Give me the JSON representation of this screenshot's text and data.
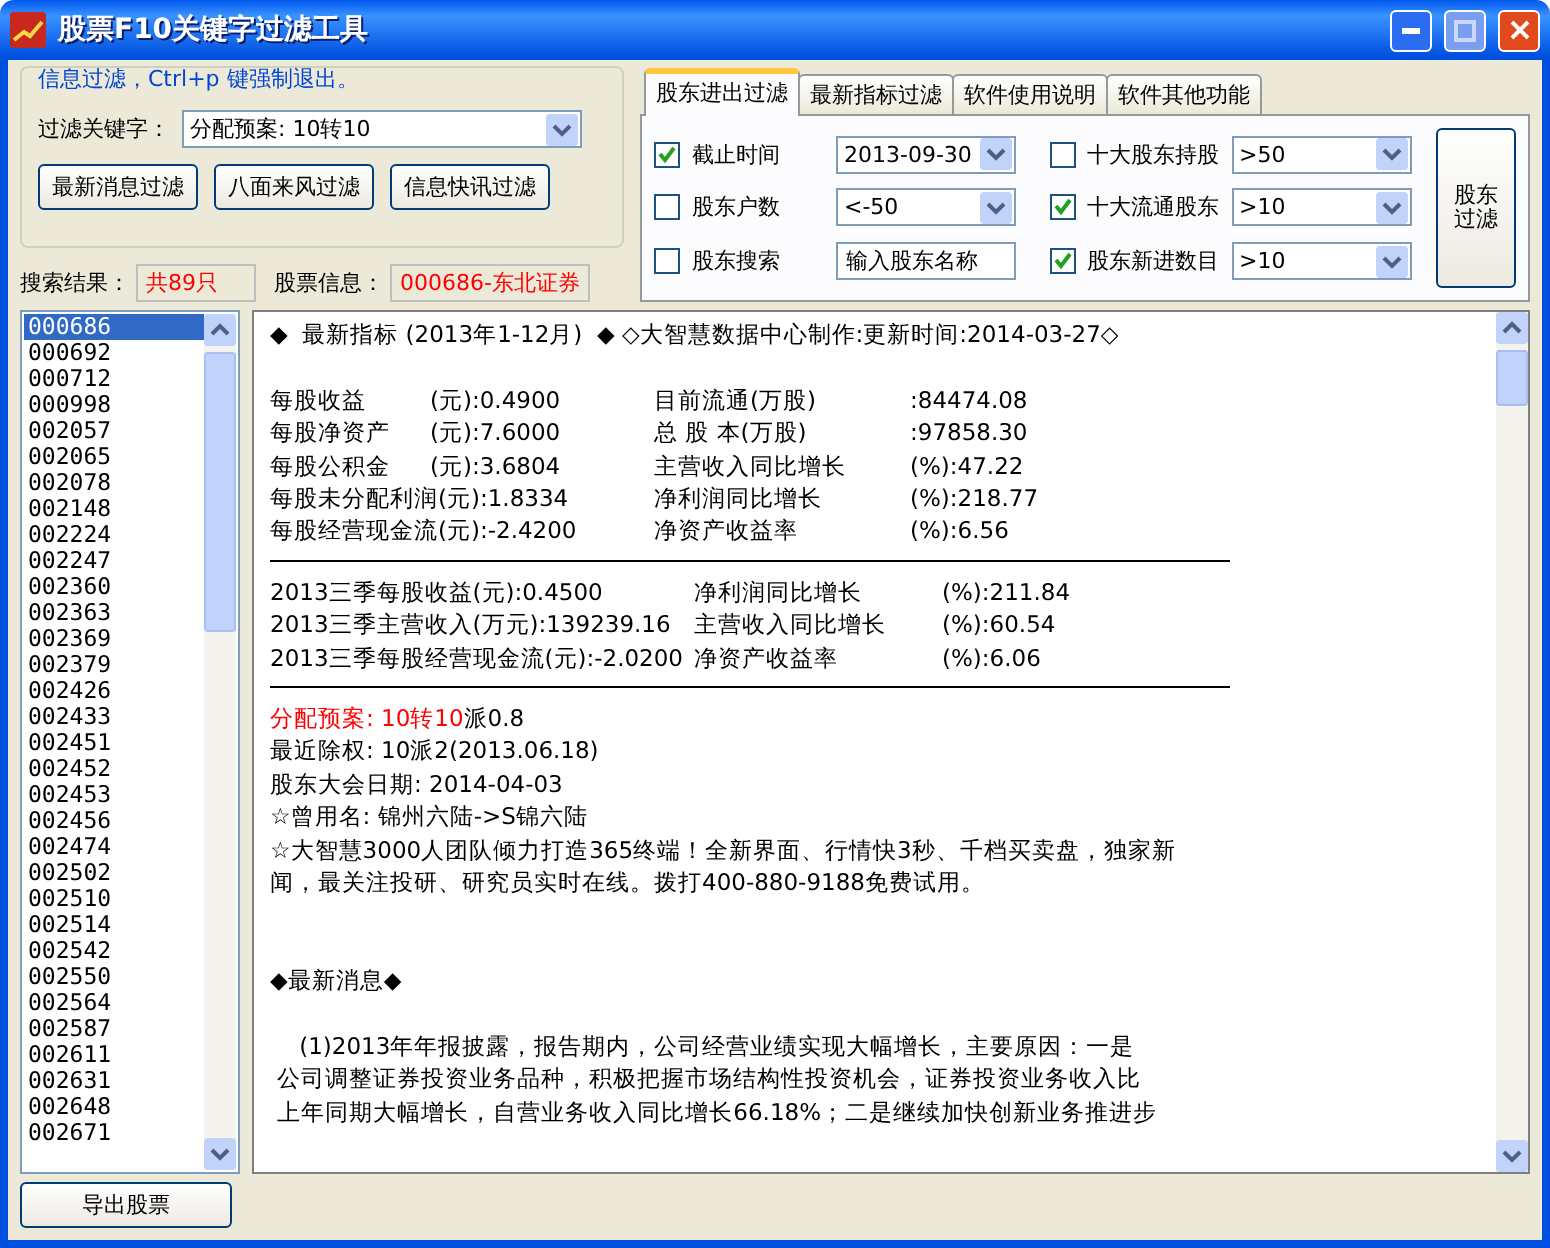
{
  "window": {
    "title": "股票F10关键字过滤工具"
  },
  "hint": "信息过滤，Ctrl+p 键强制退出。",
  "keyword": {
    "label": "过滤关键字：",
    "value": "分配预案: 10转10"
  },
  "filter_buttons": [
    "最新消息过滤",
    "八面来风过滤",
    "信息快讯过滤"
  ],
  "search": {
    "result_label": "搜索结果：",
    "result_value": "共89只",
    "info_label": "股票信息：",
    "info_value": "000686-东北证券"
  },
  "tabs": [
    {
      "label": "股东进出过滤",
      "selected": true
    },
    {
      "label": "最新指标过滤",
      "selected": false
    },
    {
      "label": "软件使用说明",
      "selected": false
    },
    {
      "label": "软件其他功能",
      "selected": false
    }
  ],
  "shareholder_filters": [
    {
      "label": "截止时间",
      "checked": true,
      "kind": "dropdown",
      "value": "2013-09-30"
    },
    {
      "label": "股东户数",
      "checked": false,
      "kind": "dropdown",
      "value": "<-50"
    },
    {
      "label": "股东搜索",
      "checked": false,
      "kind": "input",
      "value": "输入股东名称"
    },
    {
      "label": "十大股东持股",
      "checked": false,
      "kind": "dropdown",
      "value": ">50"
    },
    {
      "label": "十大流通股东",
      "checked": true,
      "kind": "dropdown",
      "value": ">10"
    },
    {
      "label": "股东新进数目",
      "checked": true,
      "kind": "dropdown",
      "value": ">10"
    }
  ],
  "shareholder_button": "股东过滤",
  "stocks": [
    {
      "code": "000686",
      "selected": true
    },
    {
      "code": "000692",
      "selected": false
    },
    {
      "code": "000712",
      "selected": false
    },
    {
      "code": "000998",
      "selected": false
    },
    {
      "code": "002057",
      "selected": false
    },
    {
      "code": "002065",
      "selected": false
    },
    {
      "code": "002078",
      "selected": false
    },
    {
      "code": "002148",
      "selected": false
    },
    {
      "code": "002224",
      "selected": false
    },
    {
      "code": "002247",
      "selected": false
    },
    {
      "code": "002360",
      "selected": false
    },
    {
      "code": "002363",
      "selected": false
    },
    {
      "code": "002369",
      "selected": false
    },
    {
      "code": "002379",
      "selected": false
    },
    {
      "code": "002426",
      "selected": false
    },
    {
      "code": "002433",
      "selected": false
    },
    {
      "code": "002451",
      "selected": false
    },
    {
      "code": "002452",
      "selected": false
    },
    {
      "code": "002453",
      "selected": false
    },
    {
      "code": "002456",
      "selected": false
    },
    {
      "code": "002474",
      "selected": false
    },
    {
      "code": "002502",
      "selected": false
    },
    {
      "code": "002510",
      "selected": false
    },
    {
      "code": "002514",
      "selected": false
    },
    {
      "code": "002542",
      "selected": false
    },
    {
      "code": "002550",
      "selected": false
    },
    {
      "code": "002564",
      "selected": false
    },
    {
      "code": "002587",
      "selected": false
    },
    {
      "code": "002611",
      "selected": false
    },
    {
      "code": "002631",
      "selected": false
    },
    {
      "code": "002648",
      "selected": false
    },
    {
      "code": "002671",
      "selected": false
    }
  ],
  "content": [
    {
      "kind": "text",
      "text": "◆  最新指标 (2013年1-12月)  ◆ ◇大智慧数据中心制作:更新时间:2014-03-27◇"
    },
    {
      "kind": "blank"
    },
    {
      "kind": "row4",
      "cells": [
        "每股收益",
        "(元):0.4900",
        "目前流通(万股)",
        ":84474.08"
      ]
    },
    {
      "kind": "row4",
      "cells": [
        "每股净资产",
        "(元):7.6000",
        "总 股 本(万股)",
        ":97858.30"
      ]
    },
    {
      "kind": "row4",
      "cells": [
        "每股公积金",
        "(元):3.6804",
        "主营收入同比增长",
        "(%):47.22"
      ]
    },
    {
      "kind": "row4",
      "cells": [
        "每股未分配利润(元):1.8334",
        "",
        "净利润同比增长",
        "(%):218.77"
      ]
    },
    {
      "kind": "row4",
      "cells": [
        "每股经营现金流(元):-2.4200",
        "",
        "净资产收益率",
        "(%):6.56"
      ]
    },
    {
      "kind": "rule"
    },
    {
      "kind": "row3",
      "cells": [
        "2013三季每股收益(元):0.4500",
        "净利润同比增长",
        "(%):211.84"
      ]
    },
    {
      "kind": "row3",
      "cells": [
        "2013三季主营收入(万元):139239.16",
        "主营收入同比增长",
        "(%):60.54"
      ]
    },
    {
      "kind": "row3",
      "cells": [
        "2013三季每股经营现金流(元):-2.0200",
        "净资产收益率",
        "(%):6.06"
      ]
    },
    {
      "kind": "rule"
    },
    {
      "kind": "parts",
      "parts": [
        {
          "text": "分配预案: 10转10",
          "highlighted": true
        },
        {
          "text": "派0.8",
          "highlighted": false
        }
      ]
    },
    {
      "kind": "text",
      "text": "最近除权: 10派2(2013.06.18)"
    },
    {
      "kind": "text",
      "text": "股东大会日期: 2014-04-03"
    },
    {
      "kind": "text",
      "text": "☆曾用名: 锦州六陆->S锦六陆"
    },
    {
      "kind": "text",
      "text": "☆大智慧3000人团队倾力打造365终端！全新界面、行情快3秒、千档买卖盘，独家新"
    },
    {
      "kind": "text",
      "text": "闻，最关注投研、研究员实时在线。拨打400-880-9188免费试用。"
    },
    {
      "kind": "blank"
    },
    {
      "kind": "blank"
    },
    {
      "kind": "text",
      "text": "◆最新消息◆"
    },
    {
      "kind": "blank"
    },
    {
      "kind": "text",
      "text": "    (1)2013年年报披露，报告期内，公司经营业绩实现大幅增长，主要原因：一是"
    },
    {
      "kind": "text",
      "text": " 公司调整证券投资业务品种，积极把握市场结构性投资机会，证券投资业务收入比"
    },
    {
      "kind": "text",
      "text": " 上年同期大幅增长，自营业务收入同比增长66.18%；二是继续加快创新业务推进步"
    }
  ],
  "export_button": "导出股票"
}
